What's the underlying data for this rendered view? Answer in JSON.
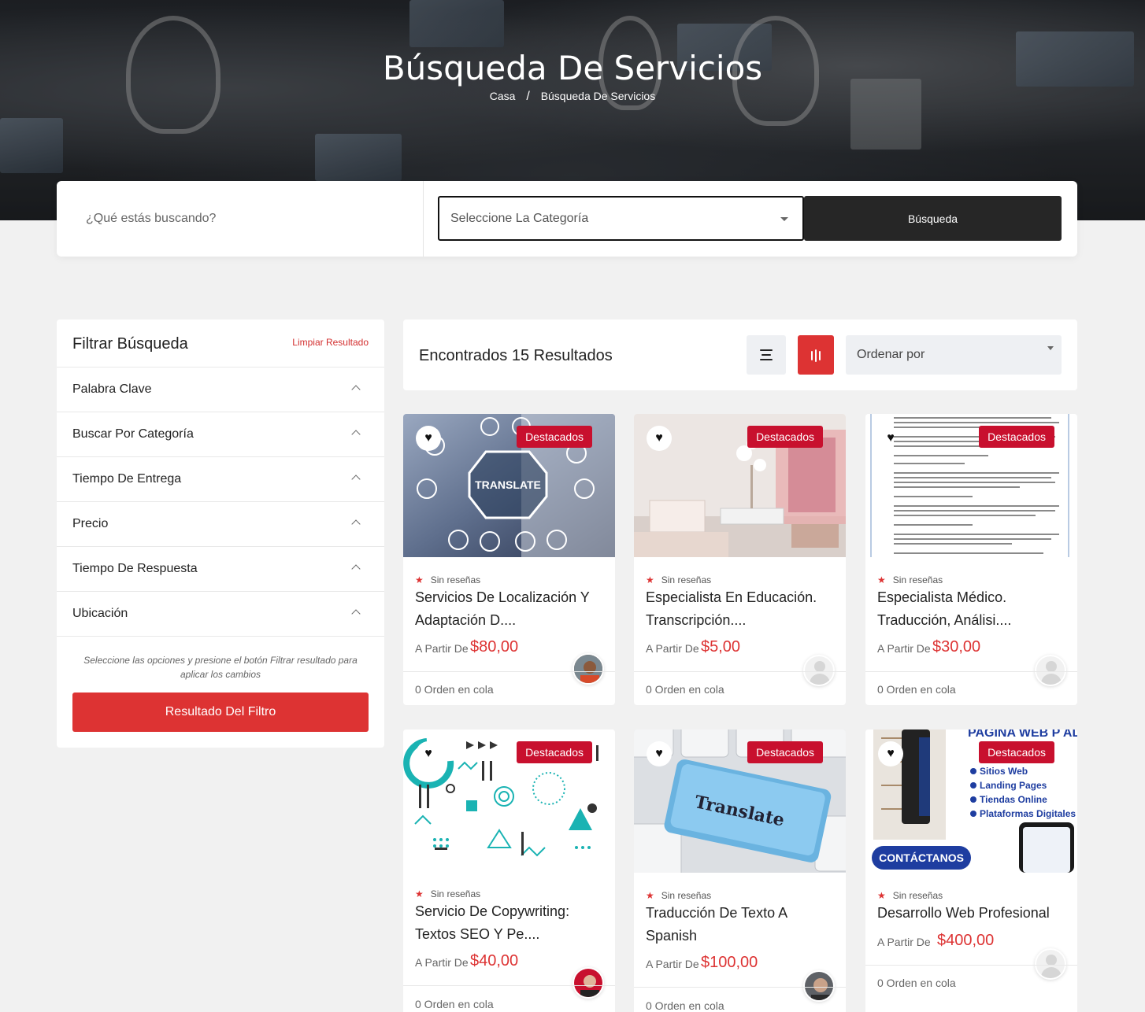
{
  "hero": {
    "title": "Búsqueda De Servicios",
    "breadcrumb": [
      "Casa",
      "Búsqueda De Servicios"
    ],
    "breadcrumb_separator": "/"
  },
  "search": {
    "placeholder": "¿Qué estás buscando?",
    "category_placeholder": "Seleccione La Categoría",
    "button_label": "Búsqueda"
  },
  "filters": {
    "title": "Filtrar Búsqueda",
    "clear_label": "Limpiar Resultado",
    "facets": [
      "Palabra Clave",
      "Buscar Por Categoría",
      "Tiempo De Entrega",
      "Precio",
      "Tiempo De Respuesta",
      "Ubicación"
    ],
    "hint": "Seleccione las opciones y presione el botón Filtrar resultado para aplicar los cambios",
    "apply_label": "Resultado Del Filtro"
  },
  "results": {
    "count_text": "Encontrados 15 Resultados",
    "sort_placeholder": "Ordenar por",
    "active_view": "grid"
  },
  "services": [
    {
      "badge": "Destacados",
      "reviews": "Sin reseñas",
      "title": "Servicios De Localización Y Adaptación D....",
      "from_label": "A Partir De",
      "price": "$80,00",
      "queue": "0 Orden en cola",
      "image_text": "TRANSLATE"
    },
    {
      "badge": "Destacados",
      "reviews": "Sin reseñas",
      "title": "Especialista En Educación. Transcripción....",
      "from_label": "A Partir De",
      "price": "$5,00",
      "queue": "0 Orden en cola"
    },
    {
      "badge": "Destacados",
      "reviews": "Sin reseñas",
      "title": "Especialista Médico. Traducción, Análisi....",
      "from_label": "A Partir De",
      "price": "$30,00",
      "queue": "0 Orden en cola"
    },
    {
      "badge": "Destacados",
      "reviews": "Sin reseñas",
      "title": "Servicio De Copywriting: Textos SEO Y Pe....",
      "from_label": "A Partir De",
      "price": "$40,00",
      "queue": "0 Orden en cola"
    },
    {
      "badge": "Destacados",
      "reviews": "Sin reseñas",
      "title": "Traducción De Texto A Spanish",
      "from_label": "A Partir De",
      "price": "$100,00",
      "queue": "0 Orden en cola",
      "image_text": "Translate"
    },
    {
      "badge": "Destacados",
      "reviews": "Sin reseñas",
      "title": "Desarrollo Web Profesional",
      "from_label": "A Partir De",
      "price": "$400,00",
      "queue": "0 Orden en cola",
      "image_heading": "PAGINA WEB P          AL",
      "image_list": [
        "Sitios Web",
        "Landing Pages",
        "Tiendas Online",
        "Plataformas Digitales"
      ],
      "image_cta": "CONTÁCTANOS"
    }
  ],
  "colors": {
    "accent": "#dd3333",
    "badge": "#c8102e",
    "dark_button": "#262626",
    "page_bg": "#f1f1f1"
  }
}
